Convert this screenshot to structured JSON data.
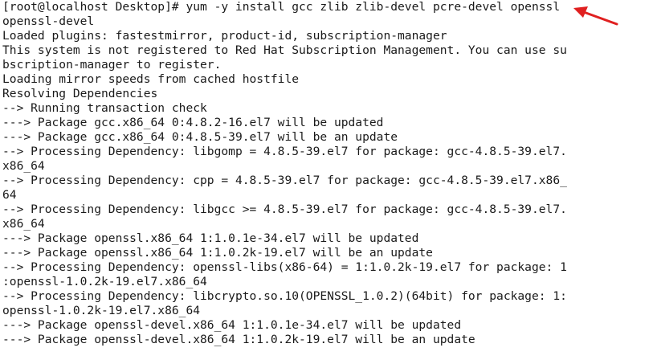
{
  "terminal": {
    "lines": [
      "[root@localhost Desktop]# yum -y install gcc zlib zlib-devel pcre-devel openssl",
      "openssl-devel",
      "Loaded plugins: fastestmirror, product-id, subscription-manager",
      "This system is not registered to Red Hat Subscription Management. You can use su",
      "bscription-manager to register.",
      "Loading mirror speeds from cached hostfile",
      "Resolving Dependencies",
      "--> Running transaction check",
      "---> Package gcc.x86_64 0:4.8.2-16.el7 will be updated",
      "---> Package gcc.x86_64 0:4.8.5-39.el7 will be an update",
      "--> Processing Dependency: libgomp = 4.8.5-39.el7 for package: gcc-4.8.5-39.el7.",
      "x86_64",
      "--> Processing Dependency: cpp = 4.8.5-39.el7 for package: gcc-4.8.5-39.el7.x86_",
      "64",
      "--> Processing Dependency: libgcc >= 4.8.5-39.el7 for package: gcc-4.8.5-39.el7.",
      "x86_64",
      "---> Package openssl.x86_64 1:1.0.1e-34.el7 will be updated",
      "---> Package openssl.x86_64 1:1.0.2k-19.el7 will be an update",
      "--> Processing Dependency: openssl-libs(x86-64) = 1:1.0.2k-19.el7 for package: 1",
      ":openssl-1.0.2k-19.el7.x86_64",
      "--> Processing Dependency: libcrypto.so.10(OPENSSL_1.0.2)(64bit) for package: 1:",
      "openssl-1.0.2k-19.el7.x86_64",
      "---> Package openssl-devel.x86_64 1:1.0.1e-34.el7 will be updated",
      "---> Package openssl-devel.x86_64 1:1.0.2k-19.el7 will be an update"
    ]
  },
  "annotation": {
    "arrow_icon": "red-arrow-icon",
    "arrow_color": "#e02020"
  }
}
